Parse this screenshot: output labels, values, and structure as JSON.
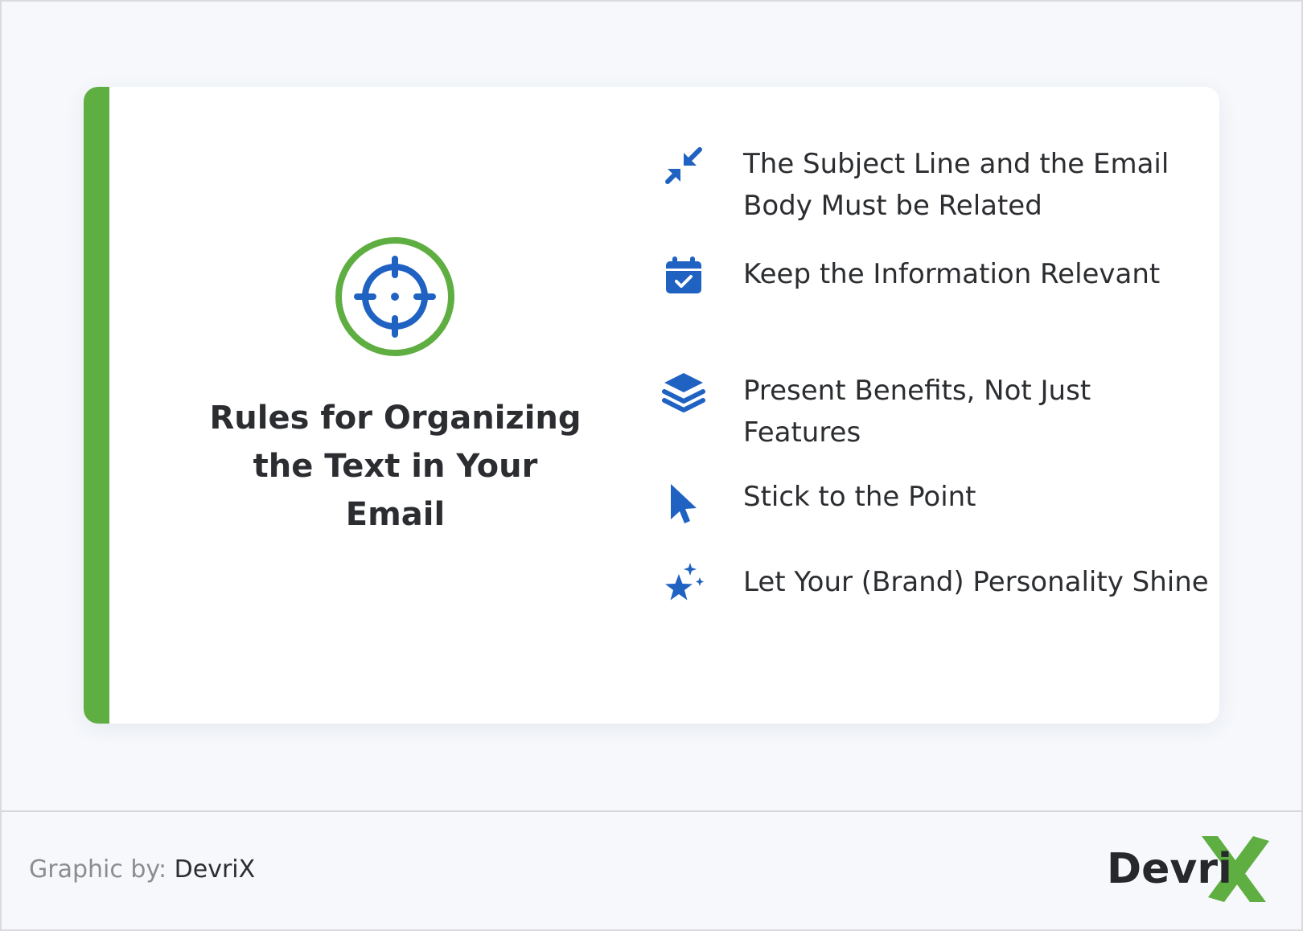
{
  "card": {
    "title": "Rules for Organizing the Text in Your Email",
    "header_icon": "crosshair-target-icon",
    "accent_color": "#5fae41",
    "icon_color": "#1f62c2"
  },
  "rules": [
    {
      "icon": "arrows-collapse-icon",
      "text": "The Subject Line and the Email Body Must be Related"
    },
    {
      "icon": "calendar-check-icon",
      "text": "Keep the Information Relevant"
    },
    {
      "icon": "layers-stack-icon",
      "text": "Present Benefits, Not Just Features"
    },
    {
      "icon": "cursor-pointer-icon",
      "text": "Stick to the Point"
    },
    {
      "icon": "sparkle-star-icon",
      "text": "Let Your (Brand) Personality Shine"
    }
  ],
  "footer": {
    "credit_label": "Graphic by:",
    "credit_brand": "DevriX",
    "logo_text": "Devri",
    "logo_mark": "X"
  }
}
